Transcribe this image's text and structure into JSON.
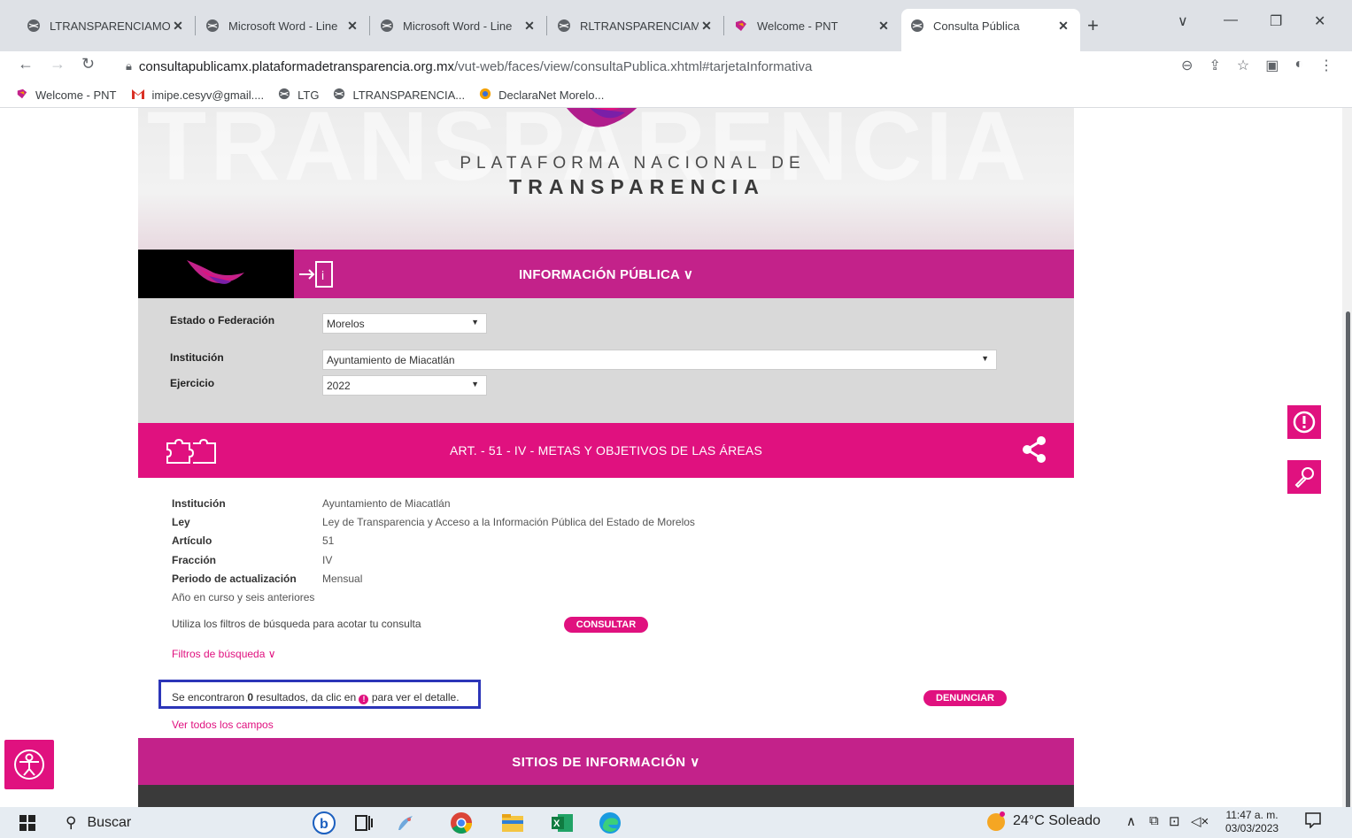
{
  "browser": {
    "tabs": [
      {
        "label": "LTRANSPARENCIAMO",
        "icon": "globe-icon",
        "active": false
      },
      {
        "label": "Microsoft Word - Line",
        "icon": "globe-icon",
        "active": false
      },
      {
        "label": "Microsoft Word - Line",
        "icon": "globe-icon",
        "active": false
      },
      {
        "label": "RLTRANSPARENCIAM",
        "icon": "globe-icon",
        "active": false
      },
      {
        "label": "Welcome - PNT",
        "icon": "pnt-icon",
        "active": false
      },
      {
        "label": "Consulta Pública",
        "icon": "globe-icon",
        "active": true
      }
    ],
    "url_host": "consultapublicamx.plataformadetransparencia.org.mx",
    "url_path": "/vut-web/faces/view/consultaPublica.xhtml#tarjetaInformativa",
    "bookmarks": [
      {
        "label": "Welcome - PNT",
        "icon": "pnt-icon"
      },
      {
        "label": "imipe.cesyv@gmail....",
        "icon": "gmail-icon"
      },
      {
        "label": "LTG",
        "icon": "globe-icon"
      },
      {
        "label": "LTRANSPARENCIA...",
        "icon": "globe-icon"
      },
      {
        "label": "DeclaraNet Morelo...",
        "icon": "declaranet-icon"
      }
    ]
  },
  "page": {
    "banner": {
      "bg_word": "TRANSPARENCIA",
      "line1": "PLATAFORMA NACIONAL DE",
      "line2": "TRANSPARENCIA"
    },
    "info_bar_label": "INFORMACIÓN PÚBLICA ∨",
    "filters": {
      "estado_label": "Estado o Federación",
      "estado_value": "Morelos",
      "institucion_label": "Institución",
      "institucion_value": "Ayuntamiento de Miacatlán",
      "ejercicio_label": "Ejercicio",
      "ejercicio_value": "2022"
    },
    "article_bar_label": "ART. - 51 - IV - METAS Y OBJETIVOS DE LAS ÁREAS",
    "details": [
      {
        "key": "Institución",
        "value": "Ayuntamiento de Miacatlán"
      },
      {
        "key": "Ley",
        "value": "Ley de Transparencia y Acceso a la Información Pública del Estado de Morelos"
      },
      {
        "key": "Artículo",
        "value": "51"
      },
      {
        "key": "Fracción",
        "value": "IV"
      },
      {
        "key": "Periodo de actualización",
        "value": "Mensual"
      }
    ],
    "period_note": "Año en curso y seis anteriores",
    "filter_hint": "Utiliza los filtros de búsqueda para acotar tu consulta",
    "consultar_label": "CONSULTAR",
    "filtros_link": "Filtros de búsqueda ∨",
    "results": {
      "prefix": "Se encontraron ",
      "count": "0",
      "middle": " resultados, da clic en ",
      "suffix": " para ver el detalle."
    },
    "denunciar_label": "DENUNCIAR",
    "ver_todos_label": "Ver todos los campos",
    "sitios_label": "SITIOS DE INFORMACIÓN ∨"
  },
  "taskbar": {
    "search_label": "Buscar",
    "weather": "24°C  Soleado",
    "time": "11:47 a. m.",
    "date": "03/03/2023"
  },
  "colors": {
    "magenta": "#c3228a",
    "pink": "#e0117f",
    "highlight_border": "#2c35b8"
  }
}
